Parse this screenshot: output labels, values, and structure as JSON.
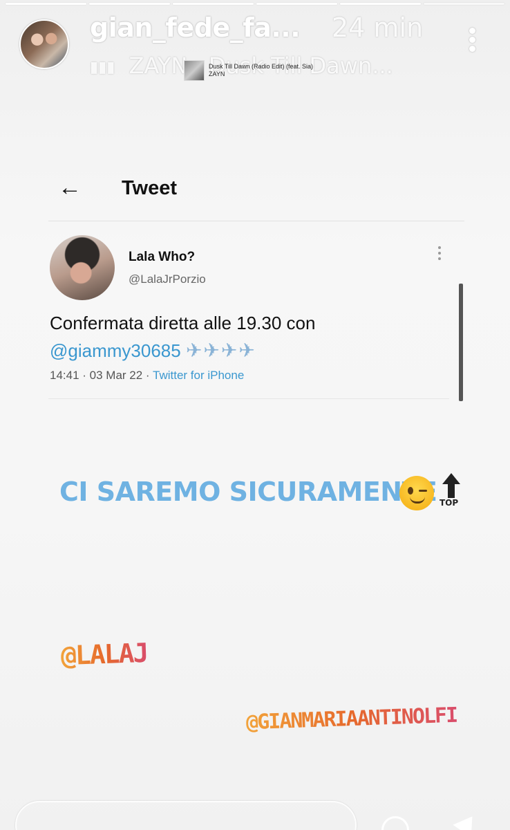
{
  "story": {
    "progress_segments": [
      1,
      1,
      1,
      1,
      1,
      0.0
    ],
    "username": "gian_fede_fa...",
    "time": "24 min",
    "music": {
      "artist": "ZAYN",
      "track": "Dusk Till Dawn...",
      "sticker_title": "Dusk Till Dawn (Radio Edit) (feat. Sia)",
      "sticker_artist": "ZAYN"
    }
  },
  "tweet": {
    "header_title": "Tweet",
    "back_icon": "arrow-left-icon",
    "author_name": "Lala Who?",
    "author_handle": "@LalaJrPorzio",
    "text_main": "Confermata diretta alle 19.30 con",
    "mention": "@giammy30685",
    "planes": "✈✈✈✈",
    "timestamp": "14:41 · 03 Mar 22 · ",
    "source": "Twitter for iPhone"
  },
  "caption": {
    "text": "CI SAREMO SICURAMENTE",
    "emoji_wink": "winking-face-emoji",
    "emoji_top": "top-arrow-emoji",
    "top_label": "TOP"
  },
  "mentions": [
    "@LALAJ",
    "@GIANMARIAANTINOLFI"
  ],
  "colors": {
    "caption_blue": "#6fb2e2",
    "twitter_blue": "#3a97cf",
    "mention_gradient_start": "#f2a33a",
    "mention_gradient_end": "#d94d6b"
  }
}
